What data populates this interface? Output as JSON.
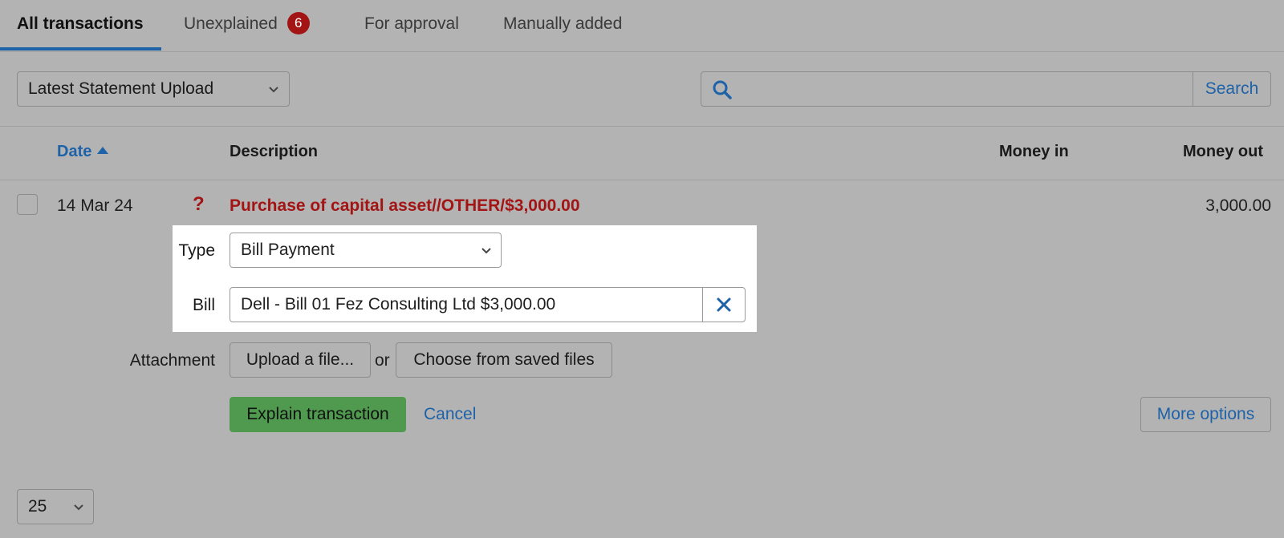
{
  "tabs": [
    {
      "label": "All transactions",
      "active": true
    },
    {
      "label": "Unexplained",
      "badge": "6"
    },
    {
      "label": "For approval"
    },
    {
      "label": "Manually added"
    }
  ],
  "filter": {
    "selected": "Latest Statement Upload"
  },
  "search": {
    "button": "Search",
    "value": ""
  },
  "columns": {
    "date": "Date",
    "description": "Description",
    "money_in": "Money in",
    "money_out": "Money out"
  },
  "transaction": {
    "date": "14 Mar 24",
    "status_icon": "?",
    "description": "Purchase of capital asset//OTHER/$3,000.00",
    "money_out": "3,000.00"
  },
  "form": {
    "type_label": "Type",
    "type_value": "Bill Payment",
    "bill_label": "Bill",
    "bill_value": "Dell - Bill 01 Fez Consulting Ltd $3,000.00",
    "attachment_label": "Attachment",
    "upload_button": "Upload a file...",
    "or_text": "or",
    "choose_button": "Choose from saved files",
    "explain_button": "Explain transaction",
    "cancel_link": "Cancel",
    "more_options_button": "More options"
  },
  "pagination": {
    "per_page": "25"
  },
  "colors": {
    "accent": "#1e62a8",
    "error": "#a31515",
    "success": "#4f9a4f",
    "badge": "#a31515"
  }
}
